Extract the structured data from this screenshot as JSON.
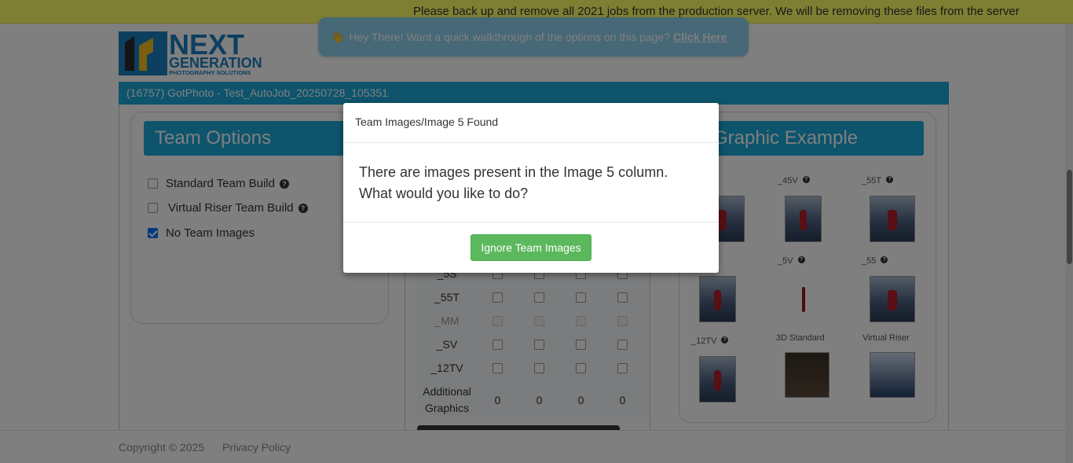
{
  "banner": {
    "text": "Please back up and remove all 2021 jobs from the production server. We will be removing these files from the server"
  },
  "logo": {
    "line1": "NEXT",
    "line2": "GENERATION",
    "line3": "PHOTOGRAPHY SOLUTIONS"
  },
  "walkthrough": {
    "text": "Hey There! Want a quick walkthrough of the options on this page?",
    "link": "Click Here"
  },
  "job": {
    "title": "(16757) GotPhoto - Test_AutoJob_20250728_105351"
  },
  "team_options": {
    "heading": "Team Options",
    "options": [
      {
        "label": "Standard Team Build",
        "checked": false
      },
      {
        "label": "Virtual Riser Team Build",
        "checked": false
      },
      {
        "label": "No Team Images",
        "checked": true
      }
    ]
  },
  "graphic_example": {
    "heading": "Graphic Example",
    "labels": [
      "_45V",
      "_55T",
      "_5V",
      "_55",
      "_12TV",
      "3D Standard",
      "Virtual Riser"
    ]
  },
  "table": {
    "rows": [
      {
        "label": "_5S",
        "faded": false
      },
      {
        "label": "_55T",
        "faded": false
      },
      {
        "label": "_MM",
        "faded": true
      },
      {
        "label": "_SV",
        "faded": false
      },
      {
        "label": "_12TV",
        "faded": false
      }
    ],
    "additional_label": "Additional Graphics",
    "additional_values": [
      "0",
      "0",
      "0",
      "0"
    ]
  },
  "footer": {
    "copyright": "Copyright © 2025",
    "privacy": "Privacy Policy"
  },
  "modal": {
    "title": "Team Images/Image 5 Found",
    "message": "There are images present in the Image 5 column. What would you like to do?",
    "button": "Ignore Team Images",
    "button_color": "#5cb85c"
  },
  "colors": {
    "accent": "#1aa8d8",
    "banner": "#ffff66"
  }
}
